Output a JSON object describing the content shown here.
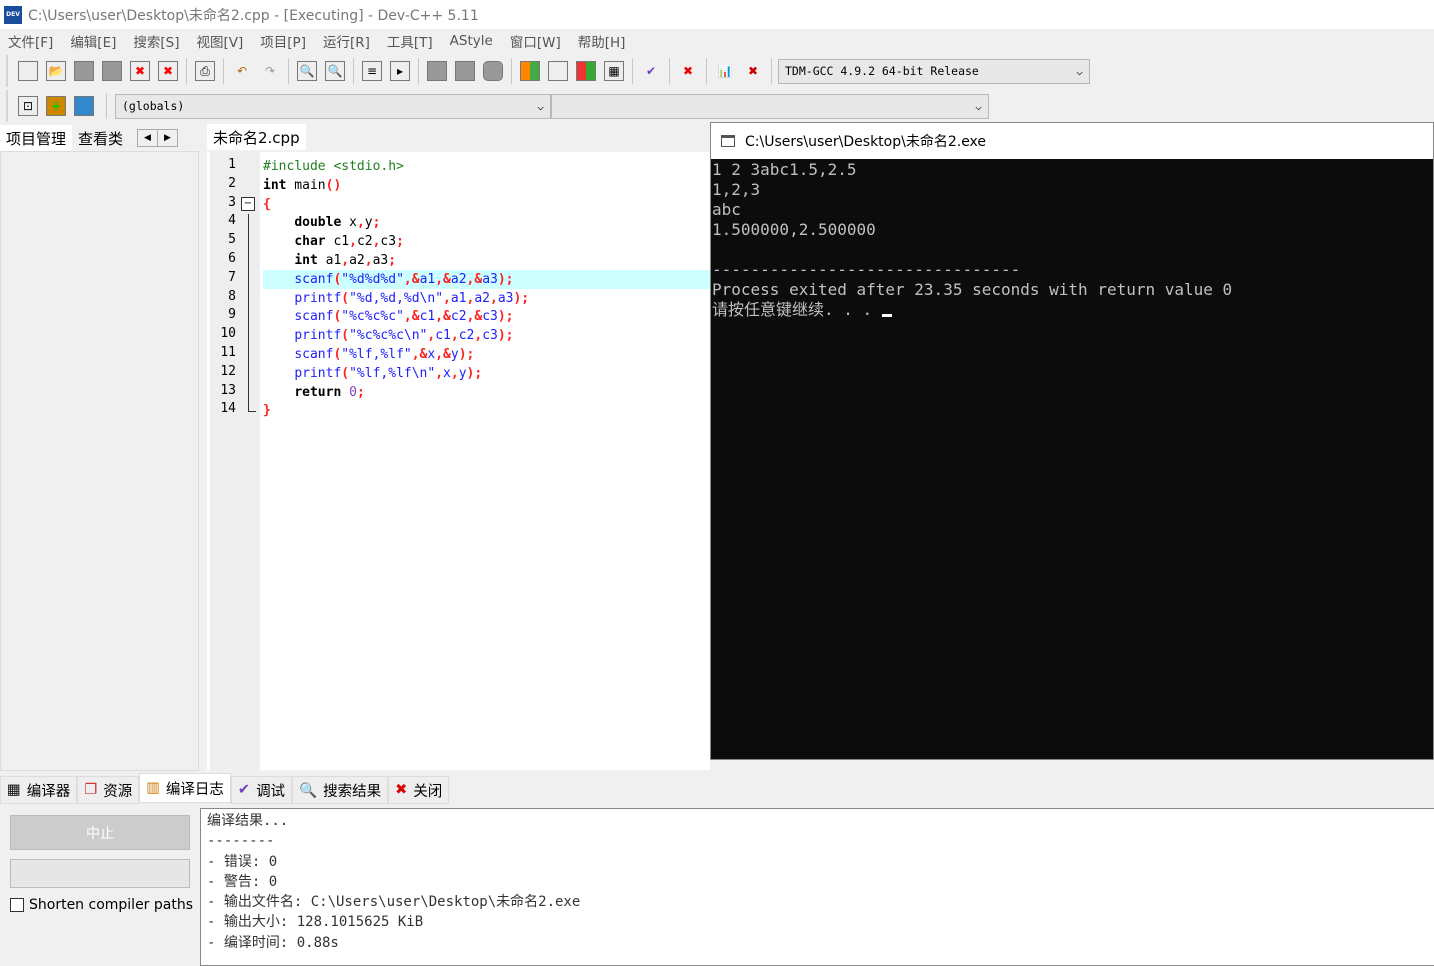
{
  "window": {
    "title": "C:\\Users\\user\\Desktop\\未命名2.cpp - [Executing] - Dev-C++ 5.11",
    "icon_label": "DEV"
  },
  "menu": [
    "文件[F]",
    "编辑[E]",
    "搜索[S]",
    "视图[V]",
    "项目[P]",
    "运行[R]",
    "工具[T]",
    "AStyle",
    "窗口[W]",
    "帮助[H]"
  ],
  "toolbar": {
    "compiler": "TDM-GCC 4.9.2 64-bit Release",
    "scope": "(globals)",
    "members": ""
  },
  "left_tabs": [
    "项目管理",
    "查看类"
  ],
  "editor_tab": "未命名2.cpp",
  "code": [
    [
      [
        "#include <stdio.h>",
        "pp"
      ]
    ],
    [
      [
        "int",
        "kw"
      ],
      [
        " main",
        "id"
      ],
      [
        "()",
        "sym"
      ]
    ],
    [
      [
        "{",
        "sym"
      ]
    ],
    [
      [
        "    ",
        "id"
      ],
      [
        "double",
        "kw"
      ],
      [
        " x",
        "id"
      ],
      [
        ",",
        "sym"
      ],
      [
        "y",
        "id"
      ],
      [
        ";",
        "sym"
      ]
    ],
    [
      [
        "    ",
        "id"
      ],
      [
        "char",
        "kw"
      ],
      [
        " c1",
        "id"
      ],
      [
        ",",
        "sym"
      ],
      [
        "c2",
        "id"
      ],
      [
        ",",
        "sym"
      ],
      [
        "c3",
        "id"
      ],
      [
        ";",
        "sym"
      ]
    ],
    [
      [
        "    ",
        "id"
      ],
      [
        "int",
        "kw"
      ],
      [
        " a1",
        "id"
      ],
      [
        ",",
        "sym"
      ],
      [
        "a2",
        "id"
      ],
      [
        ",",
        "sym"
      ],
      [
        "a3",
        "id"
      ],
      [
        ";",
        "sym"
      ]
    ],
    [
      [
        "    ",
        "id"
      ],
      [
        "scanf",
        "str"
      ],
      [
        "(",
        "sym"
      ],
      [
        "\"%d%d%d\"",
        "str"
      ],
      [
        ",&",
        "sym"
      ],
      [
        "a1",
        "str"
      ],
      [
        ",&",
        "sym"
      ],
      [
        "a2",
        "str"
      ],
      [
        ",&",
        "sym"
      ],
      [
        "a3",
        "str"
      ],
      [
        ");",
        "sym"
      ]
    ],
    [
      [
        "    ",
        "id"
      ],
      [
        "printf",
        "str"
      ],
      [
        "(",
        "sym"
      ],
      [
        "\"%d,%d,%d\\n\"",
        "str"
      ],
      [
        ",",
        "sym"
      ],
      [
        "a1",
        "str"
      ],
      [
        ",",
        "sym"
      ],
      [
        "a2",
        "str"
      ],
      [
        ",",
        "sym"
      ],
      [
        "a3",
        "str"
      ],
      [
        ");",
        "sym"
      ]
    ],
    [
      [
        "    ",
        "id"
      ],
      [
        "scanf",
        "str"
      ],
      [
        "(",
        "sym"
      ],
      [
        "\"%c%c%c\"",
        "str"
      ],
      [
        ",&",
        "sym"
      ],
      [
        "c1",
        "str"
      ],
      [
        ",&",
        "sym"
      ],
      [
        "c2",
        "str"
      ],
      [
        ",&",
        "sym"
      ],
      [
        "c3",
        "str"
      ],
      [
        ");",
        "sym"
      ]
    ],
    [
      [
        "    ",
        "id"
      ],
      [
        "printf",
        "str"
      ],
      [
        "(",
        "sym"
      ],
      [
        "\"%c%c%c\\n\"",
        "str"
      ],
      [
        ",",
        "sym"
      ],
      [
        "c1",
        "str"
      ],
      [
        ",",
        "sym"
      ],
      [
        "c2",
        "str"
      ],
      [
        ",",
        "sym"
      ],
      [
        "c3",
        "str"
      ],
      [
        ");",
        "sym"
      ]
    ],
    [
      [
        "    ",
        "id"
      ],
      [
        "scanf",
        "str"
      ],
      [
        "(",
        "sym"
      ],
      [
        "\"%lf,%lf\"",
        "str"
      ],
      [
        ",&",
        "sym"
      ],
      [
        "x",
        "str"
      ],
      [
        ",&",
        "sym"
      ],
      [
        "y",
        "str"
      ],
      [
        ");",
        "sym"
      ]
    ],
    [
      [
        "    ",
        "id"
      ],
      [
        "printf",
        "str"
      ],
      [
        "(",
        "sym"
      ],
      [
        "\"%lf,%lf\\n\"",
        "str"
      ],
      [
        ",",
        "sym"
      ],
      [
        "x",
        "str"
      ],
      [
        ",",
        "sym"
      ],
      [
        "y",
        "str"
      ],
      [
        ");",
        "sym"
      ]
    ],
    [
      [
        "    ",
        "id"
      ],
      [
        "return",
        "kw"
      ],
      [
        " ",
        "id"
      ],
      [
        "0",
        "num"
      ],
      [
        ";",
        "sym"
      ]
    ],
    [
      [
        "}",
        "sym"
      ]
    ]
  ],
  "highlighted_line": 7,
  "console": {
    "title": "C:\\Users\\user\\Desktop\\未命名2.exe",
    "lines": [
      "1 2 3abc1.5,2.5",
      "1,2,3",
      "abc",
      "1.500000,2.500000",
      "",
      "--------------------------------",
      "Process exited after 23.35 seconds with return value 0",
      "请按任意键继续. . . "
    ]
  },
  "bottom_tabs": [
    "编译器",
    "资源",
    "编译日志",
    "调试",
    "搜索结果",
    "关闭"
  ],
  "bottom_left": {
    "abort": "中止",
    "shorten_label": "Shorten compiler paths"
  },
  "log": [
    "编译结果...",
    "--------",
    "- 错误: 0",
    "- 警告: 0",
    "- 输出文件名: C:\\Users\\user\\Desktop\\未命名2.exe",
    "- 输出大小: 128.1015625 KiB",
    "- 编译时间: 0.88s"
  ]
}
